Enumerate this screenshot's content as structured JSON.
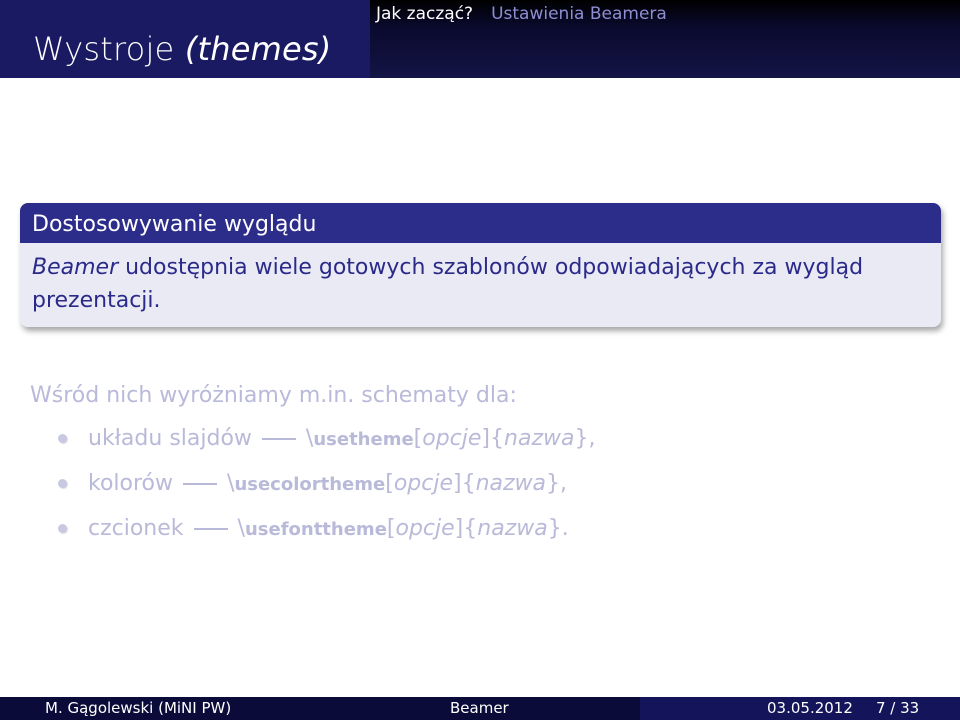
{
  "header": {
    "title_main": "Wystroje ",
    "title_italic": "(themes)",
    "nav": [
      {
        "label": "Jak zacząć?",
        "active": true
      },
      {
        "label": "Ustawienia Beamera",
        "active": false
      }
    ]
  },
  "block": {
    "title": "Dostosowywanie wyglądu",
    "body_em": "Beamer",
    "body_rest": " udostępnia wiele gotowych szablonów odpowiadających za wygląd prezentacji."
  },
  "content": {
    "intro": "Wśród nich wyróżniamy m.in. schematy dla:",
    "items": [
      {
        "label": "układu slajdów",
        "cmd_prefix": "\\",
        "cmd": "usetheme",
        "opt_open": "[",
        "opt": "opcje",
        "opt_close": "]",
        "arg_open": "{",
        "arg": "nazwa",
        "arg_close": "},"
      },
      {
        "label": "kolorów",
        "cmd_prefix": "\\",
        "cmd": "usecolortheme",
        "opt_open": "[",
        "opt": "opcje",
        "opt_close": "]",
        "arg_open": "{",
        "arg": "nazwa",
        "arg_close": "},"
      },
      {
        "label": "czcionek",
        "cmd_prefix": "\\",
        "cmd": "usefonttheme",
        "opt_open": "[",
        "opt": "opcje",
        "opt_close": "]",
        "arg_open": "{",
        "arg": "nazwa",
        "arg_close": "}."
      }
    ]
  },
  "footer": {
    "author": "M. Gągolewski (MiNI PW)",
    "title": "Beamer",
    "date": "03.05.2012",
    "page": "7 / 33"
  },
  "colors": {
    "header_left": "#1a1a63",
    "block_title": "#2c2c8a",
    "block_body": "#eaeaf4",
    "faded_text": "#b9b9d9",
    "nav_inactive": "#8e8ed2"
  }
}
